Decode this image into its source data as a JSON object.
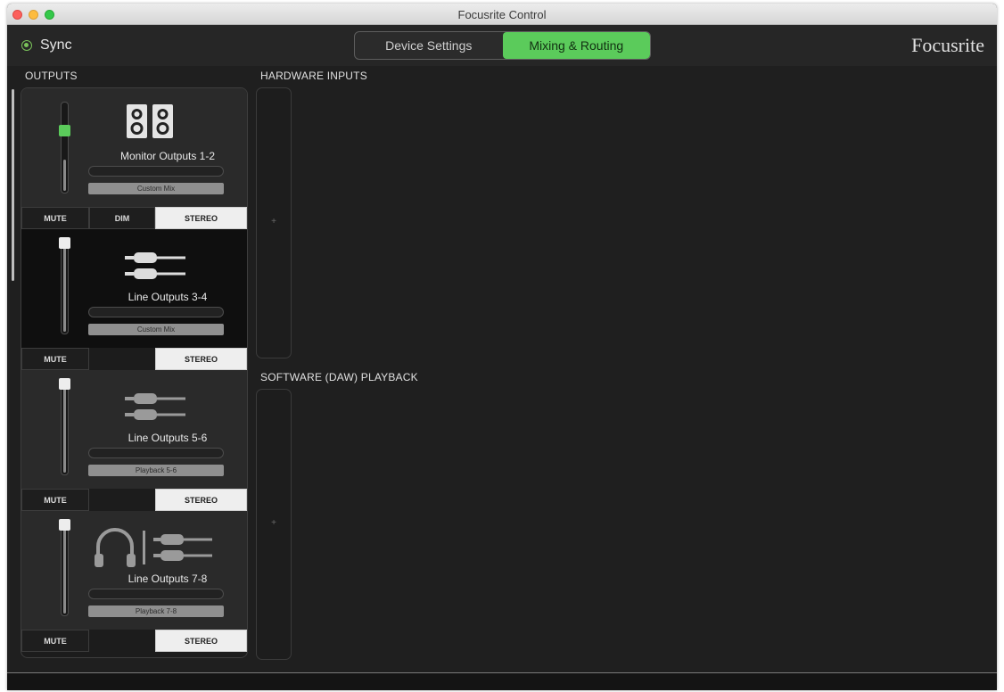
{
  "window": {
    "title": "Focusrite Control"
  },
  "header": {
    "sync_label": "Sync",
    "tabs": [
      {
        "label": "Device Settings",
        "active": false
      },
      {
        "label": "Mixing & Routing",
        "active": true
      }
    ],
    "brand": "Focusrite",
    "accent_color": "#5bcb5b"
  },
  "sections": {
    "outputs": "OUTPUTS",
    "hardware_inputs": "HARDWARE INPUTS",
    "software_playback": "SOFTWARE (DAW) PLAYBACK"
  },
  "outputs": [
    {
      "name": "Monitor Outputs 1-2",
      "icon": "speakers-icon",
      "source": "Custom Mix",
      "mute_label": "MUTE",
      "dim_label": "DIM",
      "stereo_label": "STEREO",
      "fader_level": 0.7
    },
    {
      "name": "Line Outputs 3-4",
      "icon": "line-jacks-icon",
      "source": "Custom Mix",
      "mute_label": "MUTE",
      "stereo_label": "STEREO",
      "fader_level": 1.0
    },
    {
      "name": "Line Outputs 5-6",
      "icon": "line-jacks-icon",
      "source": "Playback 5-6",
      "mute_label": "MUTE",
      "stereo_label": "STEREO",
      "fader_level": 1.0
    },
    {
      "name": "Line Outputs 7-8",
      "icon": "headphones-line-icon",
      "source": "Playback 7-8",
      "mute_label": "MUTE",
      "stereo_label": "STEREO",
      "fader_level": 1.0
    }
  ],
  "slots": {
    "hardware_plus": "+",
    "software_plus": "+"
  }
}
